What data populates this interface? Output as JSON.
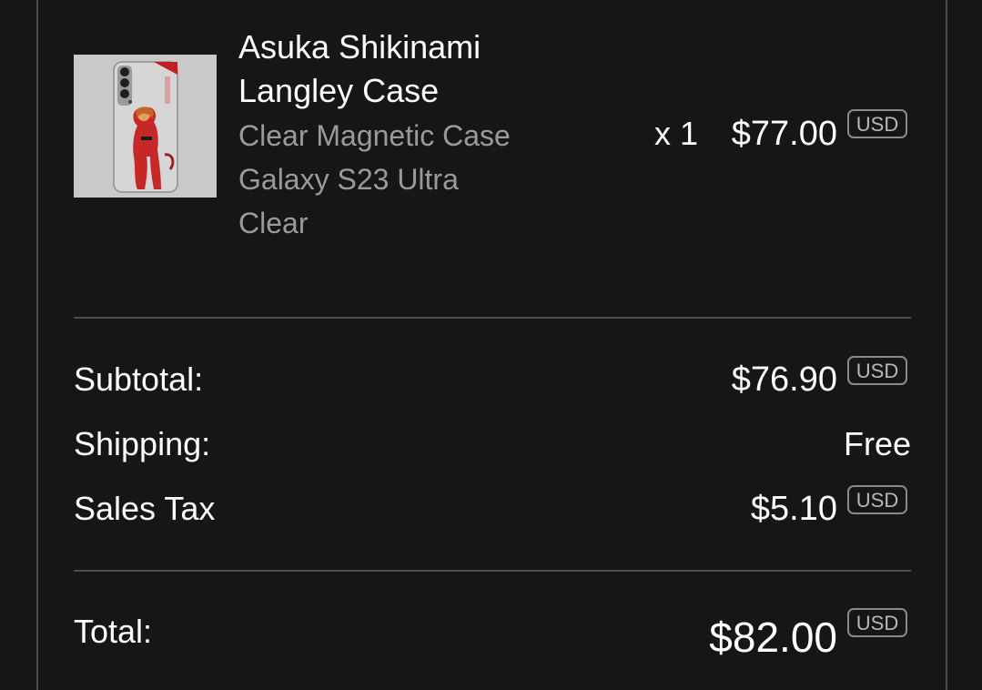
{
  "item": {
    "image_icon": "product-thumbnail-phone-case",
    "title_line1": "Asuka Shikinami",
    "title_line2": "Langley Case",
    "variant": "Clear Magnetic Case",
    "device": "Galaxy S23 Ultra",
    "color": "Clear",
    "quantity": "x 1",
    "price": "$77.00",
    "currency": "USD"
  },
  "summary": {
    "subtotal_label": "Subtotal:",
    "subtotal_value": "$76.90",
    "subtotal_currency": "USD",
    "shipping_label": "Shipping:",
    "shipping_value": "Free",
    "tax_label": "Sales Tax",
    "tax_value": "$5.10",
    "tax_currency": "USD"
  },
  "total": {
    "label": "Total:",
    "value": "$82.00",
    "currency": "USD"
  },
  "colors": {
    "background": "#161616",
    "text_primary": "#ffffff",
    "text_secondary": "#9a9a9a",
    "divider": "#4d4d4d"
  }
}
